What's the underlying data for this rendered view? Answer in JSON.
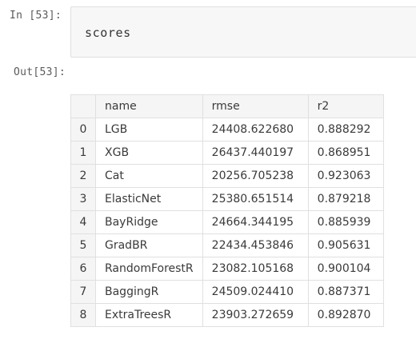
{
  "input_cell": {
    "prompt": "In [53]:",
    "code": "scores"
  },
  "output_cell": {
    "prompt": "Out[53]:",
    "table": {
      "index_header": "",
      "columns": [
        "name",
        "rmse",
        "r2"
      ],
      "rows": [
        {
          "index": "0",
          "name": "LGB",
          "rmse": "24408.622680",
          "r2": "0.888292"
        },
        {
          "index": "1",
          "name": "XGB",
          "rmse": "26437.440197",
          "r2": "0.868951"
        },
        {
          "index": "2",
          "name": "Cat",
          "rmse": "20256.705238",
          "r2": "0.923063"
        },
        {
          "index": "3",
          "name": "ElasticNet",
          "rmse": "25380.651514",
          "r2": "0.879218"
        },
        {
          "index": "4",
          "name": "BayRidge",
          "rmse": "24664.344195",
          "r2": "0.885939"
        },
        {
          "index": "5",
          "name": "GradBR",
          "rmse": "22434.453846",
          "r2": "0.905631"
        },
        {
          "index": "6",
          "name": "RandomForestR",
          "rmse": "23082.105168",
          "r2": "0.900104"
        },
        {
          "index": "7",
          "name": "BaggingR",
          "rmse": "24509.024410",
          "r2": "0.887371"
        },
        {
          "index": "8",
          "name": "ExtraTreesR",
          "rmse": "23903.272659",
          "r2": "0.892870"
        }
      ]
    }
  }
}
